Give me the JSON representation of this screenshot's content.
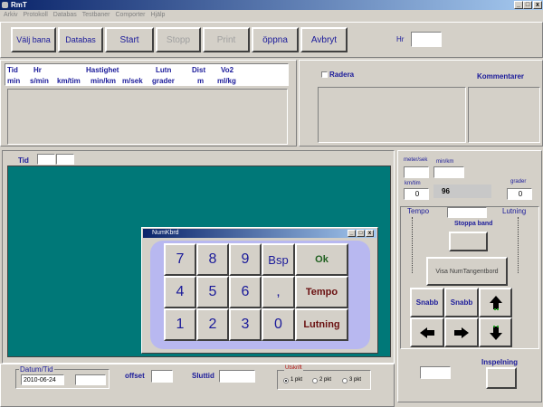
{
  "window": {
    "title": "RmT"
  },
  "menu": [
    "Arkiv",
    "Protokoll",
    "Databas",
    "Testbaner",
    "Comporter",
    "Hjälp"
  ],
  "toolbar": {
    "valj_bana": "Välj bana",
    "databas": "Databas",
    "start": "Start",
    "stopp": "Stopp",
    "print": "Print",
    "oppna": "öppna",
    "avbryt": "Avbryt",
    "hr_label": "Hr",
    "hr_value": ""
  },
  "table_header": {
    "row1": [
      "Tid",
      "Hr",
      "Hastighet",
      "Lutn",
      "Dist",
      "Vo2"
    ],
    "row2": [
      "min",
      "s/min",
      "km/tim",
      "min/km",
      "m/sek",
      "grader",
      "m",
      "ml/kg"
    ]
  },
  "comments": {
    "radera": "Radera",
    "kommentarer": "Kommentarer"
  },
  "tid": {
    "label": "Tid",
    "value1": "",
    "value2": ""
  },
  "right_panel": {
    "meter_sek": "meter/sek",
    "min_km": "min/km",
    "km_tim": "km/tim",
    "km_tim_value": "0",
    "center_value": "96",
    "grader": "grader",
    "grader_value": "0",
    "tempo": "Tempo",
    "lutning": "Lutning",
    "stoppa_band": "Stoppa band",
    "visa_num": "Visa NumTangentbord",
    "snabb1": "Snabb",
    "snabb2": "Snabb",
    "inspelning": "Inspelning"
  },
  "numpad": {
    "title": "NumKbrd",
    "keys": [
      "7",
      "8",
      "9",
      "Bsp",
      "Ok",
      "4",
      "5",
      "6",
      ",",
      "Tempo",
      "1",
      "2",
      "3",
      "0",
      "Lutning"
    ]
  },
  "bottom": {
    "datum_tid": "Datum/Tid",
    "date_value": "2010-06-24",
    "offset": "offset",
    "sluttid": "Sluttid",
    "utskrift": "Utskrift",
    "radio1": "1 pkt",
    "radio2": "2 pkt",
    "radio3": "3 pkt"
  },
  "colors": {
    "teal": "#007878",
    "label_blue": "#1a1a9a",
    "numpad_bg": "#b8b8f0"
  }
}
